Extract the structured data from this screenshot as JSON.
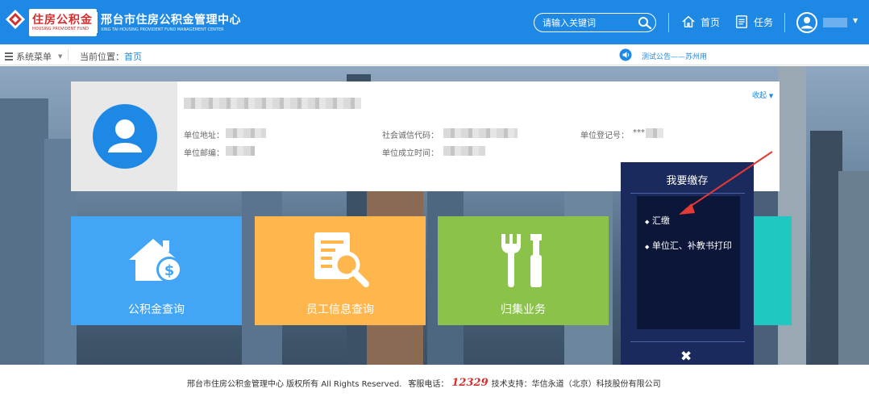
{
  "header": {
    "logo_cn": "住房公积金",
    "logo_en": "HOUSING PROVIDENT FUND",
    "center_name": "邢台市住房公积金管理中心",
    "center_en": "XING TAI HOUSING PROVIDENT FUND MANAGEMENT CENTER",
    "search_placeholder": "请输入关键词",
    "nav": [
      {
        "label": "首页",
        "icon": "home-icon"
      },
      {
        "label": "任务",
        "icon": "task-icon"
      }
    ],
    "user_caret": "▼"
  },
  "subbar": {
    "system_menu": "系统菜单",
    "location_prefix": "当前位置：",
    "location_current": "首页",
    "notice": "测试公告——苏州用"
  },
  "info_card": {
    "collapse": "收起",
    "fields": {
      "address": "单位地址：",
      "credit_code": "社会诚信代码：",
      "registration_no": "单位登记号：",
      "registration_value": "***",
      "postcode": "单位邮编：",
      "founded": "单位成立时间："
    }
  },
  "tiles": [
    {
      "label": "公积金查询",
      "color": "#42a5f5",
      "icon": "house-money-icon"
    },
    {
      "label": "员工信息查询",
      "color": "#ffb74d",
      "icon": "document-search-icon"
    },
    {
      "label": "归集业务",
      "color": "#8bc34a",
      "icon": "tools-icon"
    },
    {
      "label": "",
      "color": "#1fc8c0",
      "icon": "money-bag-icon"
    }
  ],
  "popup": {
    "title": "我要缴存",
    "items": [
      "汇缴",
      "单位汇、补教书打印"
    ],
    "close": "✖",
    "bullet": "◆"
  },
  "footer": {
    "copyright": "邢台市住房公积金管理中心 版权所有 All Rights Reserved.",
    "hotline_label": "客服电话：",
    "hotline": "12329",
    "support": "技术支持：华信永道（北京）科技股份有限公司"
  },
  "colors": {
    "header_bg": "#1e88e5",
    "popup_bg": "#1a2a5c",
    "accent_red": "#d32f2f"
  }
}
